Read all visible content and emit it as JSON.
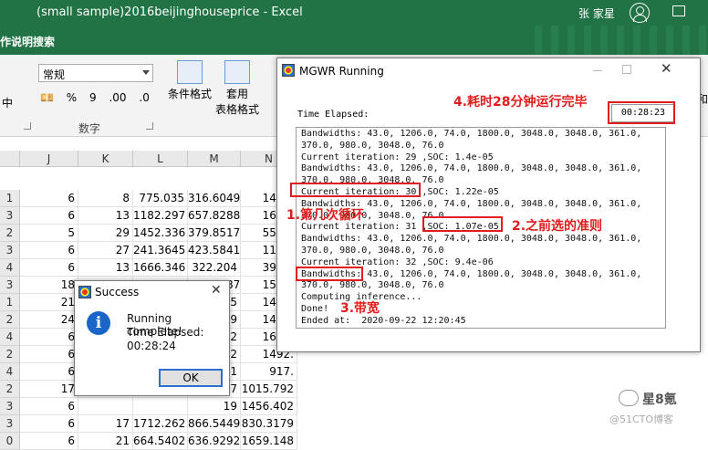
{
  "excel": {
    "title": "(small sample)2016beijinghouseprice  -  Excel",
    "user": "张 家星",
    "tell_me": "作说明搜索",
    "ribbon": {
      "mid_partial": "中",
      "number_format": "常规",
      "currency": "💴",
      "percent": "%",
      "comma": "9",
      "inc_dec": ".00",
      "dec_dec": ".0",
      "number_group": "数字",
      "cond_format": "条件格式",
      "apply_label": "套用",
      "table_format": "表格格式",
      "right_partial_1": "序和",
      "right_partial_2": "编辑"
    },
    "columns": [
      "J",
      "K",
      "L",
      "M",
      "N"
    ],
    "rows": [
      {
        "h": "1",
        "c": [
          "6",
          "8",
          "775.035",
          "316.6049",
          "1484."
        ]
      },
      {
        "h": "3",
        "c": [
          "6",
          "13",
          "1182.297",
          "657.8288",
          "1608."
        ]
      },
      {
        "h": "2",
        "c": [
          "5",
          "29",
          "1452.336",
          "379.8517",
          "551.6"
        ]
      },
      {
        "h": "3",
        "c": [
          "6",
          "27",
          "241.3645",
          "423.5841",
          "1123."
        ]
      },
      {
        "h": "4",
        "c": [
          "6",
          "13",
          "1666.346",
          "322.204",
          "395.6"
        ]
      },
      {
        "h": "3",
        "c": [
          "18",
          "12",
          "667.8985",
          "329.9287",
          "1552."
        ]
      },
      {
        "h": "1",
        "c": [
          "21",
          "",
          "",
          "35",
          "1433."
        ]
      },
      {
        "h": "2",
        "c": [
          "24",
          "",
          "",
          "99",
          "1425."
        ]
      },
      {
        "h": "4",
        "c": [
          "6",
          "",
          "",
          "92",
          "1640."
        ]
      },
      {
        "h": "2",
        "c": [
          "6",
          "",
          "",
          "22",
          "1492."
        ]
      },
      {
        "h": "4",
        "c": [
          "6",
          "",
          "",
          "11",
          "917."
        ]
      },
      {
        "h": "2",
        "c": [
          "17",
          "",
          "",
          "37",
          "1015.792"
        ]
      },
      {
        "h": "3",
        "c": [
          "6",
          "",
          "",
          "19",
          "1456.402"
        ]
      },
      {
        "h": "3",
        "c": [
          "6",
          "17",
          "1712.262",
          "866.5449",
          "830.3179"
        ]
      },
      {
        "h": "0",
        "c": [
          "6",
          "21",
          "664.5402",
          "636.9292",
          "1659.148"
        ]
      }
    ]
  },
  "mgwr": {
    "title": "MGWR Running",
    "elapsed_label": "Time Elapsed:",
    "elapsed_value": "00:28:23",
    "log": [
      "Bandwidths: 43.0, 1206.0, 74.0, 1800.0, 3048.0, 3048.0, 361.0,",
      "370.0, 980.0, 3048.0, 76.0",
      "Current iteration: 29 ,SOC: 1.4e-05",
      "Bandwidths: 43.0, 1206.0, 74.0, 1800.0, 3048.0, 3048.0, 361.0,",
      "370.0, 980.0, 3048.0, 76.0",
      "Current iteration: 30 ,SOC: 1.22e-05",
      "Bandwidths: 43.0, 1206.0, 74.0, 1800.0, 3048.0, 3048.0, 361.0,",
      "370.0, 980.0, 3048.0, 76.0",
      "Current iteration: 31 ,SOC: 1.07e-05",
      "Bandwidths: 43.0, 1206.0, 74.0, 1800.0, 3048.0, 3048.0, 361.0,",
      "370.0, 980.0, 3048.0, 76.0",
      "Current iteration: 32 ,SOC: 9.4e-06",
      "Bandwidths: 43.0, 1206.0, 74.0, 1800.0, 3048.0, 3048.0, 361.0,",
      "370.0, 980.0, 3048.0, 76.0",
      "Computing inference...",
      "Done!",
      "Ended at:  2020-09-22 12:20:45"
    ]
  },
  "success": {
    "title": "Success",
    "line1": "Running complete!",
    "line2": "Time Elapsed:",
    "line3": "00:28:24",
    "ok": "OK"
  },
  "annotations": {
    "a1": "1.第几次循环",
    "a2": "2.之前选的准则",
    "a3": "3.带宽",
    "a4": "4.耗时28分钟运行完毕"
  },
  "watermark": {
    "name": "星8氪",
    "site": "@51CTO博客"
  }
}
